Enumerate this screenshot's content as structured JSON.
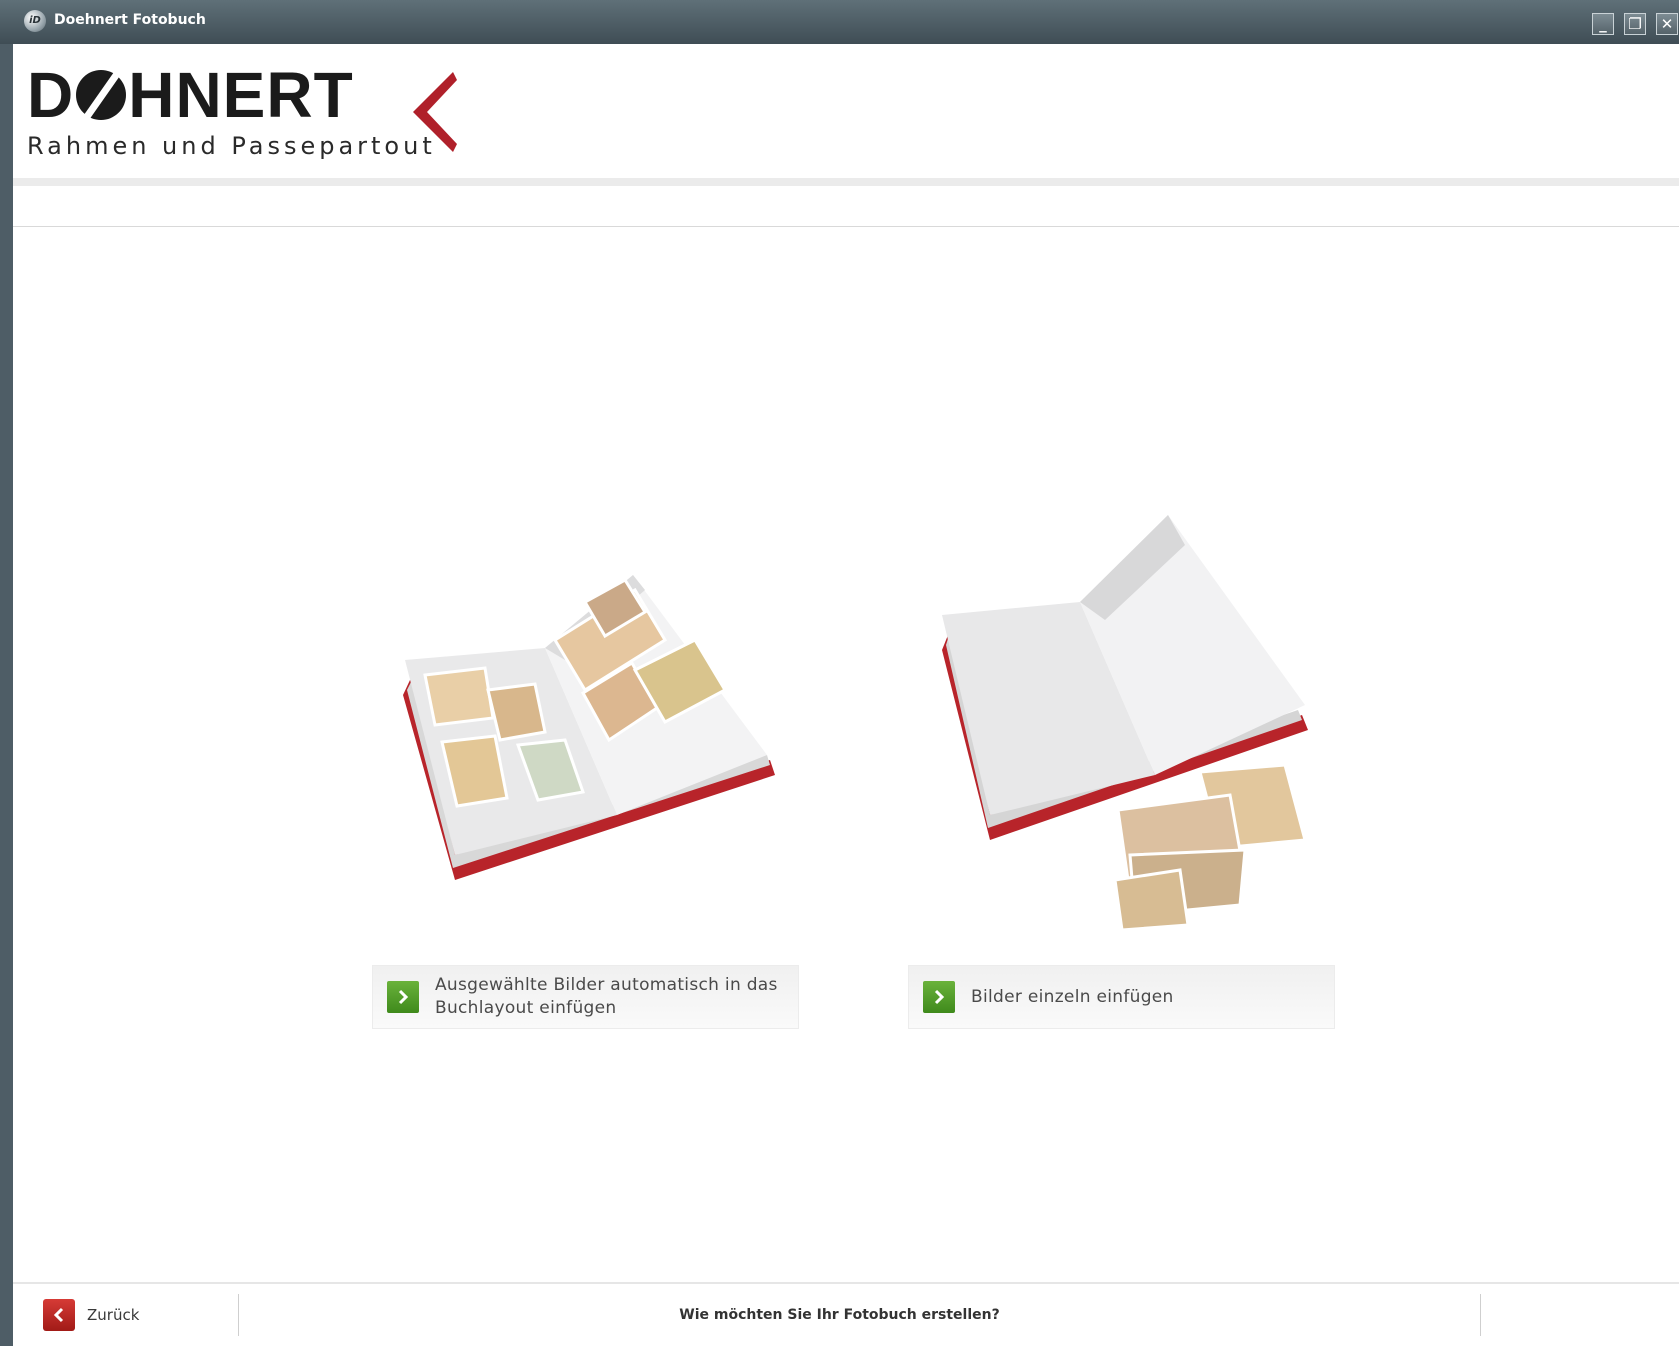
{
  "window": {
    "title": "Doehnert Fotobuch",
    "icon_label": "iD",
    "minimize_symbol": "_",
    "restore_symbol": "❐",
    "close_symbol": "✕"
  },
  "brand": {
    "logo_text_start": "D",
    "logo_text_end": "HNERT",
    "tagline": "Rahmen und Passepartout",
    "accent_color": "#b0202a"
  },
  "options": [
    {
      "label_line1": "Ausgewählte Bilder automatisch in das",
      "label_line2": "Buchlayout einfügen"
    },
    {
      "label_line1": "Bilder einzeln einfügen"
    }
  ],
  "footer": {
    "back_label": "Zurück",
    "question": "Wie möchten Sie Ihr Fotobuch erstellen?"
  }
}
